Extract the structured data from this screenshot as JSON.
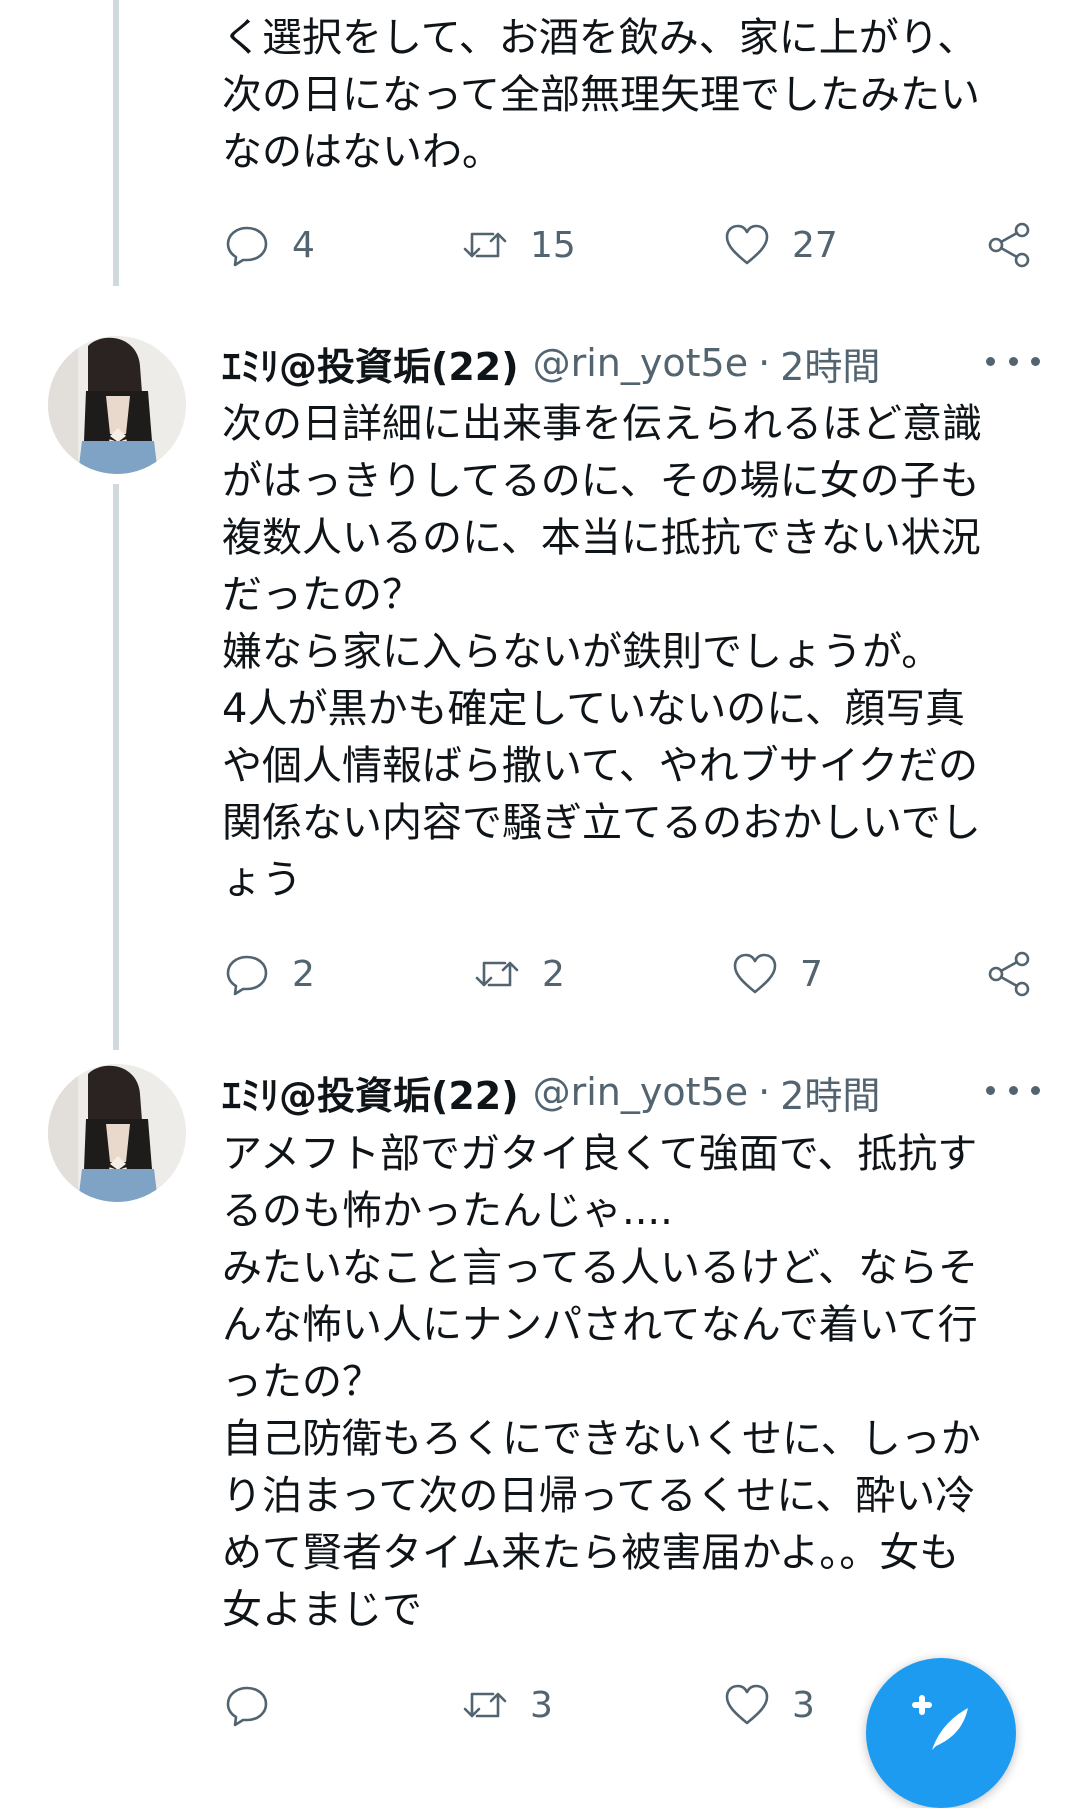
{
  "tweets": [
    {
      "text_lines": [
        "く選択をして、お酒を飲み、家に上がり、",
        "次の日になって全部無理矢理でしたみたい",
        "なのはないわ。"
      ],
      "replies": "4",
      "retweets": "15",
      "likes": "27"
    },
    {
      "name": "ｴﾐﾘ@投資垢(22)",
      "handle": "@rin_yot5e",
      "separator": "·",
      "time": "2時間",
      "text_lines": [
        "次の日詳細に出来事を伝えられるほど意識",
        "がはっきりしてるのに、その場に女の子も",
        "複数人いるのに、本当に抵抗できない状況",
        "だったの？",
        "嫌なら家に入らないが鉄則でしょうが。",
        "4人が黒かも確定していないのに、顔写真",
        "や個人情報ばら撒いて、やれブサイクだの",
        "関係ない内容で騒ぎ立てるのおかしいでし",
        "ょう"
      ],
      "replies": "2",
      "retweets": "2",
      "likes": "7"
    },
    {
      "name": "ｴﾐﾘ@投資垢(22)",
      "handle": "@rin_yot5e",
      "separator": "·",
      "time": "2時間",
      "text_lines": [
        "アメフト部でガタイ良くて強面で、抵抗す",
        "るのも怖かったんじゃ....",
        "みたいなこと言ってる人いるけど、ならそ",
        "んな怖い人にナンパされてなんで着いて行",
        "ったの？",
        "自己防衛もろくにできないくせに、しっか",
        "り泊まって次の日帰ってるくせに、酔い冷",
        "めて賢者タイム来たら被害届かよ。。女も",
        "女よまじで"
      ],
      "replies": "",
      "retweets": "3",
      "likes": "3"
    }
  ],
  "icons": {
    "reply": "reply-icon",
    "retweet": "retweet-icon",
    "like": "heart-icon",
    "share": "share-icon",
    "more": "more-icon",
    "compose": "compose-icon"
  },
  "colors": {
    "accent": "#1d9bf0",
    "secondary_text": "#536471",
    "thread_line": "#cfd9de",
    "text": "#0f1419"
  }
}
